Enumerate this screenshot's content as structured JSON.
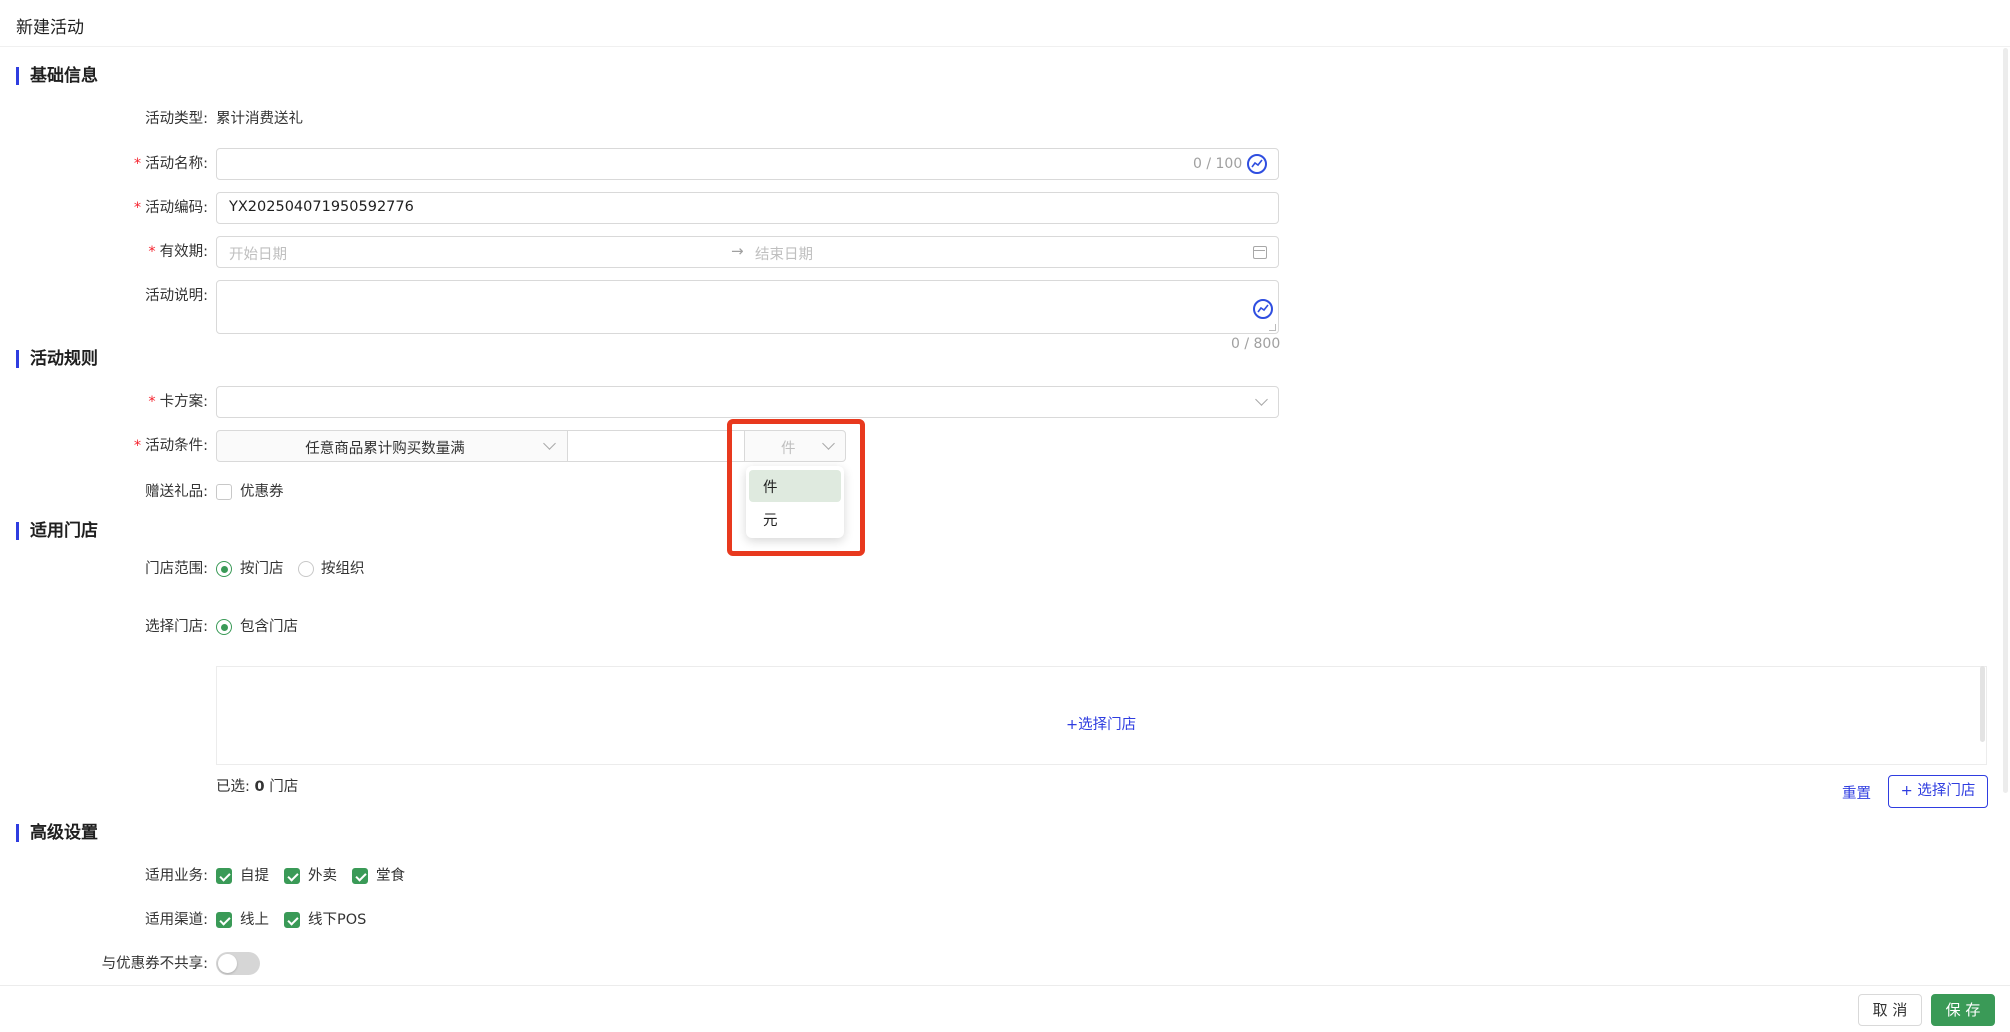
{
  "page": {
    "title": "新建活动"
  },
  "sections": {
    "basic": "基础信息",
    "rules": "活动规则",
    "stores": "适用门店",
    "advanced": "高级设置"
  },
  "basic": {
    "type_label": "活动类型:",
    "type_value": "累计消费送礼",
    "name_label": "活动名称:",
    "name_value": "",
    "name_counter": "0 / 100",
    "code_label": "活动编码:",
    "code_value": "YX202504071950592776",
    "period_label": "有效期:",
    "start_placeholder": "开始日期",
    "end_placeholder": "结束日期",
    "arrow": "→",
    "desc_label": "活动说明:",
    "desc_counter": "0 / 800"
  },
  "rules": {
    "card_label": "卡方案:",
    "card_value": "",
    "condition_label": "活动条件:",
    "condition_type": "任意商品累计购买数量满",
    "condition_amount": "",
    "unit_selected": "件",
    "unit_options": [
      "件",
      "元"
    ],
    "gift_label": "赠送礼品:",
    "gift_coupon": "优惠券"
  },
  "stores": {
    "scope_label": "门店范围:",
    "scope_by_store": "按门店",
    "scope_by_org": "按组织",
    "select_label": "选择门店:",
    "include_store": "包含门店",
    "pick_link": "+选择门店",
    "selected_prefix": "已选: ",
    "selected_count": "0",
    "selected_suffix": " 门店",
    "reset": "重置",
    "select_button": "+ 选择门店"
  },
  "advanced": {
    "business_label": "适用业务:",
    "business": [
      "自提",
      "外卖",
      "堂食"
    ],
    "channel_label": "适用渠道:",
    "channels": [
      "线上",
      "线下POS"
    ],
    "nonshare_label": "与优惠券不共享:",
    "nonshare_on": false
  },
  "footer": {
    "cancel": "取 消",
    "save": "保 存"
  },
  "colors": {
    "accent": "#2f3de0",
    "primary_green": "#3a9a57",
    "highlight_red": "#e8391e"
  }
}
